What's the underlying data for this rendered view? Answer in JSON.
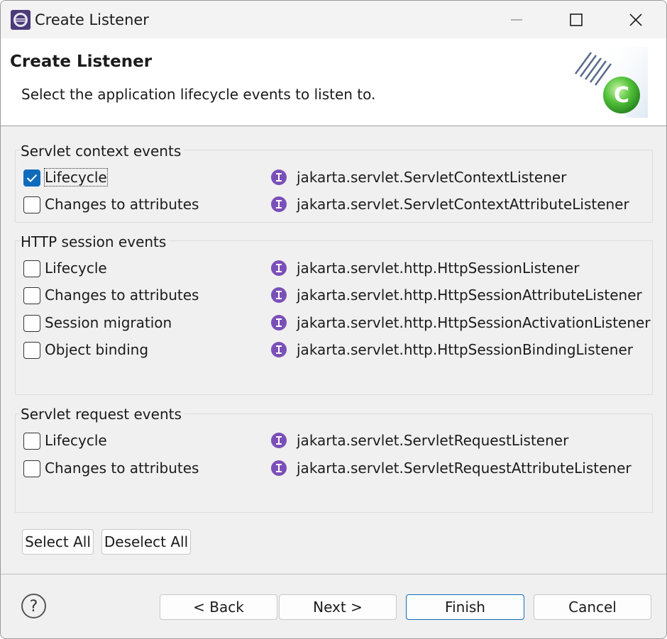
{
  "window": {
    "title": "Create Listener",
    "icon": "eclipse-icon",
    "controls": [
      "minimize-icon",
      "maximize-icon",
      "close-icon"
    ]
  },
  "banner": {
    "title": "Create Listener",
    "description": "Select the application lifecycle events to listen to.",
    "graphic": "class-wizard-icon"
  },
  "groups": [
    {
      "title": "Servlet context events",
      "rows": [
        {
          "label": "Lifecycle",
          "checked": true,
          "interface": "jakarta.servlet.ServletContextListener"
        },
        {
          "label": "Changes to attributes",
          "checked": false,
          "interface": "jakarta.servlet.ServletContextAttributeListener"
        }
      ]
    },
    {
      "title": "HTTP session events",
      "rows": [
        {
          "label": "Lifecycle",
          "checked": false,
          "interface": "jakarta.servlet.http.HttpSessionListener"
        },
        {
          "label": "Changes to attributes",
          "checked": false,
          "interface": "jakarta.servlet.http.HttpSessionAttributeListener"
        },
        {
          "label": "Session migration",
          "checked": false,
          "interface": "jakarta.servlet.http.HttpSessionActivationListener"
        },
        {
          "label": "Object binding",
          "checked": false,
          "interface": "jakarta.servlet.http.HttpSessionBindingListener"
        }
      ]
    },
    {
      "title": "Servlet request events",
      "rows": [
        {
          "label": "Lifecycle",
          "checked": false,
          "interface": "jakarta.servlet.ServletRequestListener"
        },
        {
          "label": "Changes to attributes",
          "checked": false,
          "interface": "jakarta.servlet.ServletRequestAttributeListener"
        }
      ]
    }
  ],
  "selection_buttons": {
    "select_all": "Select All",
    "deselect_all": "Deselect All"
  },
  "footer": {
    "help_icon": "help-icon",
    "back": "< Back",
    "next": "Next >",
    "finish": "Finish",
    "cancel": "Cancel"
  },
  "colors": {
    "accent": "#0f6cbd",
    "interface_icon": "#7b4fb8",
    "class_icon": "#3fae3f"
  }
}
